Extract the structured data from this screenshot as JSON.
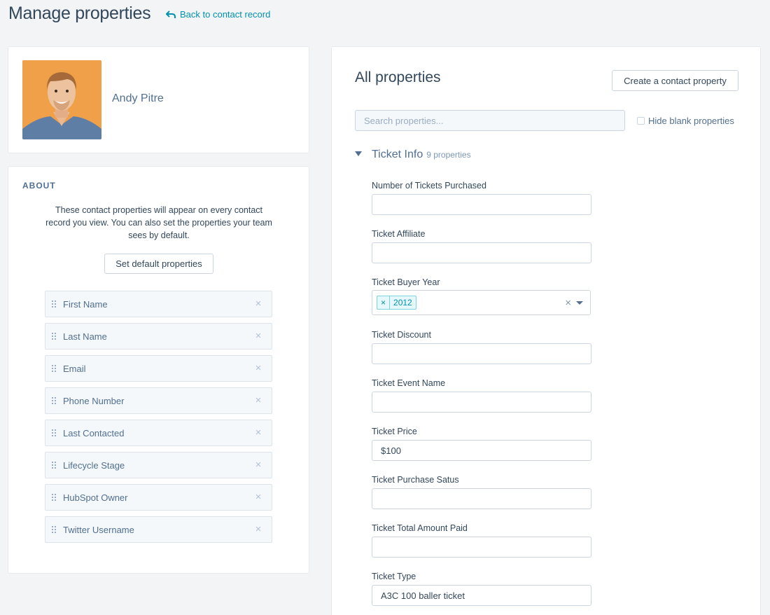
{
  "header": {
    "title": "Manage properties",
    "back_link": "Back to contact record"
  },
  "contact": {
    "name": "Andy Pitre"
  },
  "about": {
    "heading": "ABOUT",
    "description": "These contact properties will appear on every contact record you view. You can also set the properties your team sees by default.",
    "set_default_label": "Set default properties",
    "properties": [
      {
        "label": "First Name"
      },
      {
        "label": "Last Name"
      },
      {
        "label": "Email"
      },
      {
        "label": "Phone Number"
      },
      {
        "label": "Last Contacted"
      },
      {
        "label": "Lifecycle Stage"
      },
      {
        "label": "HubSpot Owner"
      },
      {
        "label": "Twitter Username"
      }
    ],
    "remove_glyph": "×"
  },
  "all_properties": {
    "title": "All properties",
    "create_label": "Create a contact property",
    "search_placeholder": "Search properties...",
    "hide_blank_label": "Hide blank properties",
    "group": {
      "name": "Ticket Info",
      "count": "9 properties"
    },
    "fields": [
      {
        "label": "Number of Tickets Purchased",
        "value": ""
      },
      {
        "label": "Ticket Affiliate",
        "value": ""
      },
      {
        "label": "Ticket Buyer Year",
        "tag": "2012",
        "tag_remove": "×",
        "clear": "×"
      },
      {
        "label": "Ticket Discount",
        "value": ""
      },
      {
        "label": "Ticket Event Name",
        "value": ""
      },
      {
        "label": "Ticket Price",
        "value": "$100"
      },
      {
        "label": "Ticket Purchase Satus",
        "value": ""
      },
      {
        "label": "Ticket Total Amount Paid",
        "value": ""
      },
      {
        "label": "Ticket Type",
        "value": "A3C 100 baller ticket"
      }
    ]
  },
  "colors": {
    "link": "#0091ae",
    "text": "#33475b",
    "background": "#f2f4f6"
  }
}
